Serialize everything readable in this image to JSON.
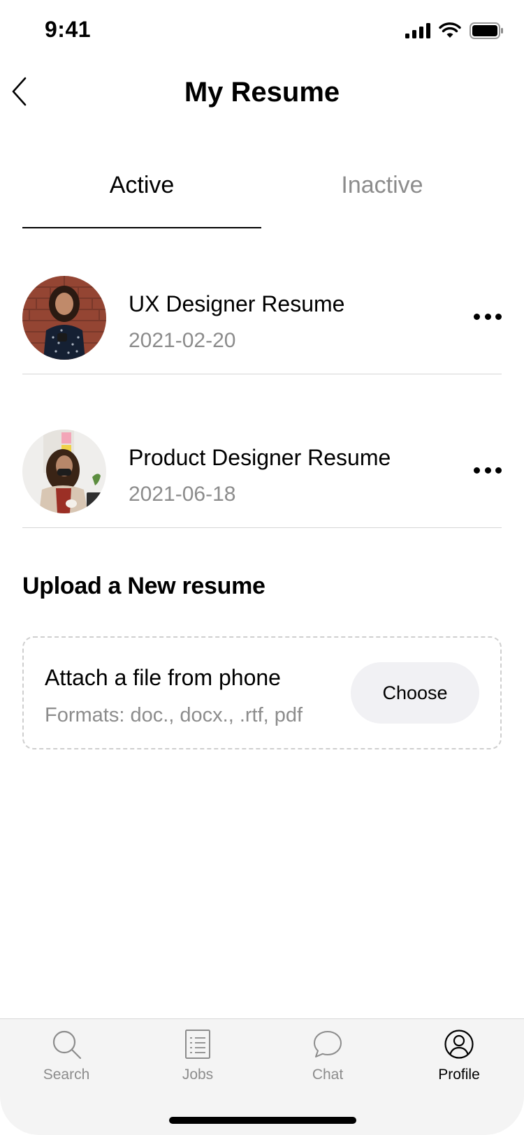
{
  "status_bar": {
    "time": "9:41"
  },
  "header": {
    "title": "My Resume"
  },
  "tabs": [
    {
      "label": "Active",
      "active": true
    },
    {
      "label": "Inactive",
      "active": false
    }
  ],
  "resumes": [
    {
      "title": "UX Designer Resume",
      "date": "2021-02-20"
    },
    {
      "title": "Product Designer Resume",
      "date": "2021-06-18"
    }
  ],
  "upload": {
    "heading": "Upload a New resume",
    "title": "Attach a file from phone",
    "formats": "Formats: doc., docx., .rtf, pdf",
    "button_label": "Choose"
  },
  "nav": [
    {
      "label": "Search",
      "icon": "search-icon",
      "active": false
    },
    {
      "label": "Jobs",
      "icon": "list-icon",
      "active": false
    },
    {
      "label": "Chat",
      "icon": "chat-icon",
      "active": false
    },
    {
      "label": "Profile",
      "icon": "profile-icon",
      "active": true
    }
  ],
  "colors": {
    "active_text": "#000000",
    "inactive_text": "#8c8c8c",
    "tabbar_bg": "#f4f4f4"
  }
}
